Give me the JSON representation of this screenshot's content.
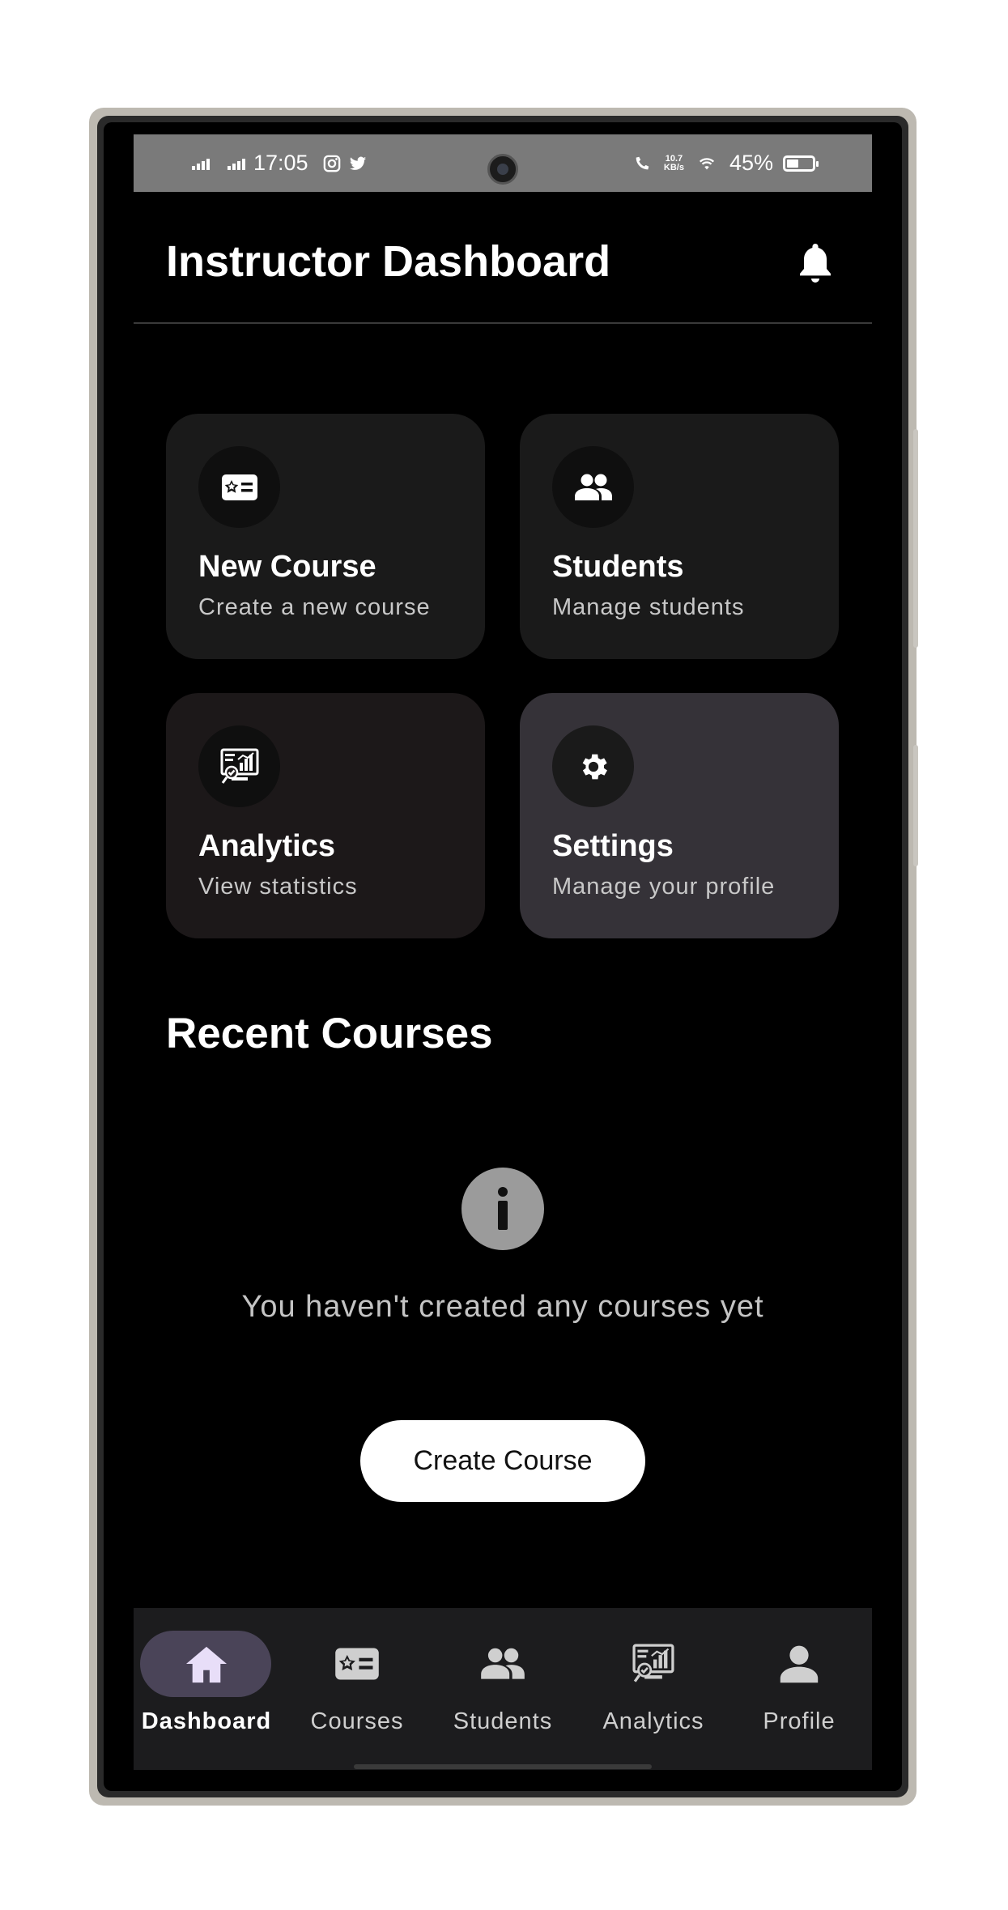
{
  "status_bar": {
    "time": "17:05",
    "net_speed_value": "10.7",
    "net_speed_unit": "KB/s",
    "battery": "45%"
  },
  "header": {
    "title": "Instructor Dashboard",
    "bell_icon": "bell-icon"
  },
  "cards": [
    {
      "title": "New Course",
      "subtitle": "Create a new course",
      "icon": "course-card-icon",
      "bg": "#1a1a1a"
    },
    {
      "title": "Students",
      "subtitle": "Manage students",
      "icon": "students-icon",
      "bg": "#1a1a1a"
    },
    {
      "title": "Analytics",
      "subtitle": "View statistics",
      "icon": "analytics-icon",
      "bg": "#1c1819"
    },
    {
      "title": "Settings",
      "subtitle": "Manage your profile",
      "icon": "gear-icon",
      "bg": "#353238"
    }
  ],
  "recent_courses": {
    "title": "Recent Courses",
    "empty_message": "You haven't created any courses yet",
    "cta_label": "Create Course"
  },
  "bottom_nav": {
    "active": "Dashboard",
    "active_color": "#4a4458",
    "items": [
      {
        "label": "Dashboard",
        "icon": "home-icon"
      },
      {
        "label": "Courses",
        "icon": "course-card-icon"
      },
      {
        "label": "Students",
        "icon": "students-icon"
      },
      {
        "label": "Analytics",
        "icon": "analytics-icon"
      },
      {
        "label": "Profile",
        "icon": "person-icon"
      }
    ]
  }
}
